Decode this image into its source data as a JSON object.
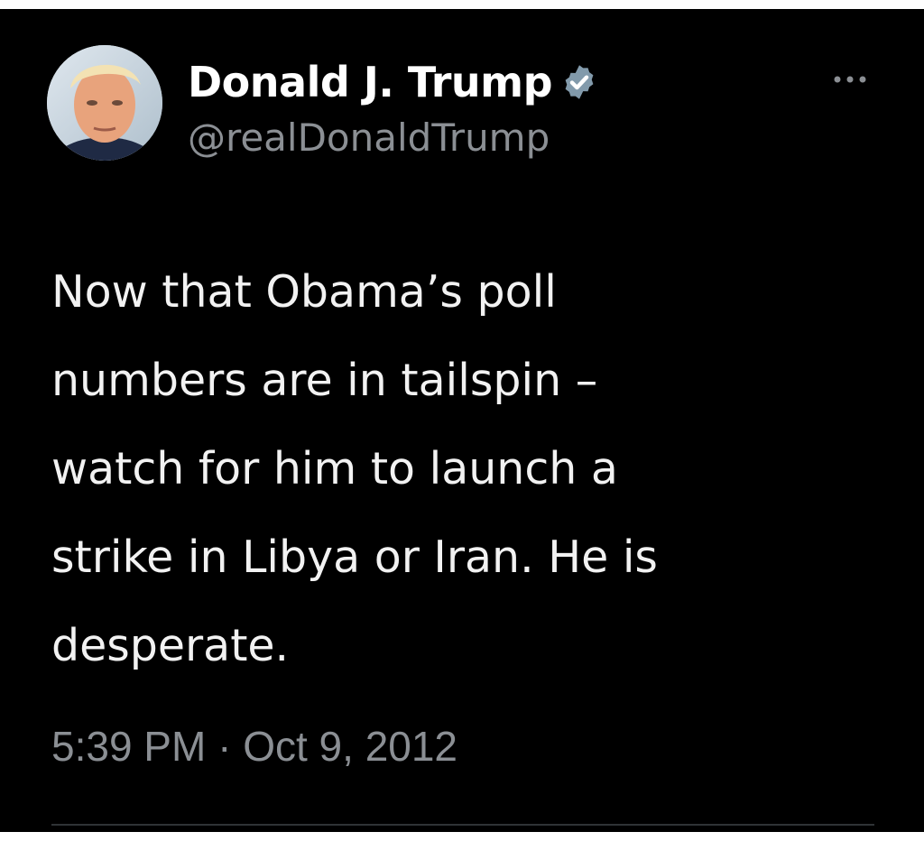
{
  "tweet": {
    "author": {
      "display_name": "Donald J. Trump",
      "handle": "@realDonaldTrump",
      "verified": true,
      "avatar_icon": "profile-photo",
      "verified_icon": "verified-badge-icon"
    },
    "text": "Now that Obama’s poll\nnumbers are in tailspin –\nwatch for him to launch a\nstrike in Libya or Iran.  He is\ndesperate.",
    "time": "5:39 PM",
    "separator": "·",
    "date": "Oct 9, 2012",
    "more_icon": "more-options-icon"
  },
  "colors": {
    "background": "#000000",
    "text": "#f2f2f2",
    "secondary_text": "#8b8f94",
    "divider": "#2f3336",
    "badge": "#829aab"
  }
}
